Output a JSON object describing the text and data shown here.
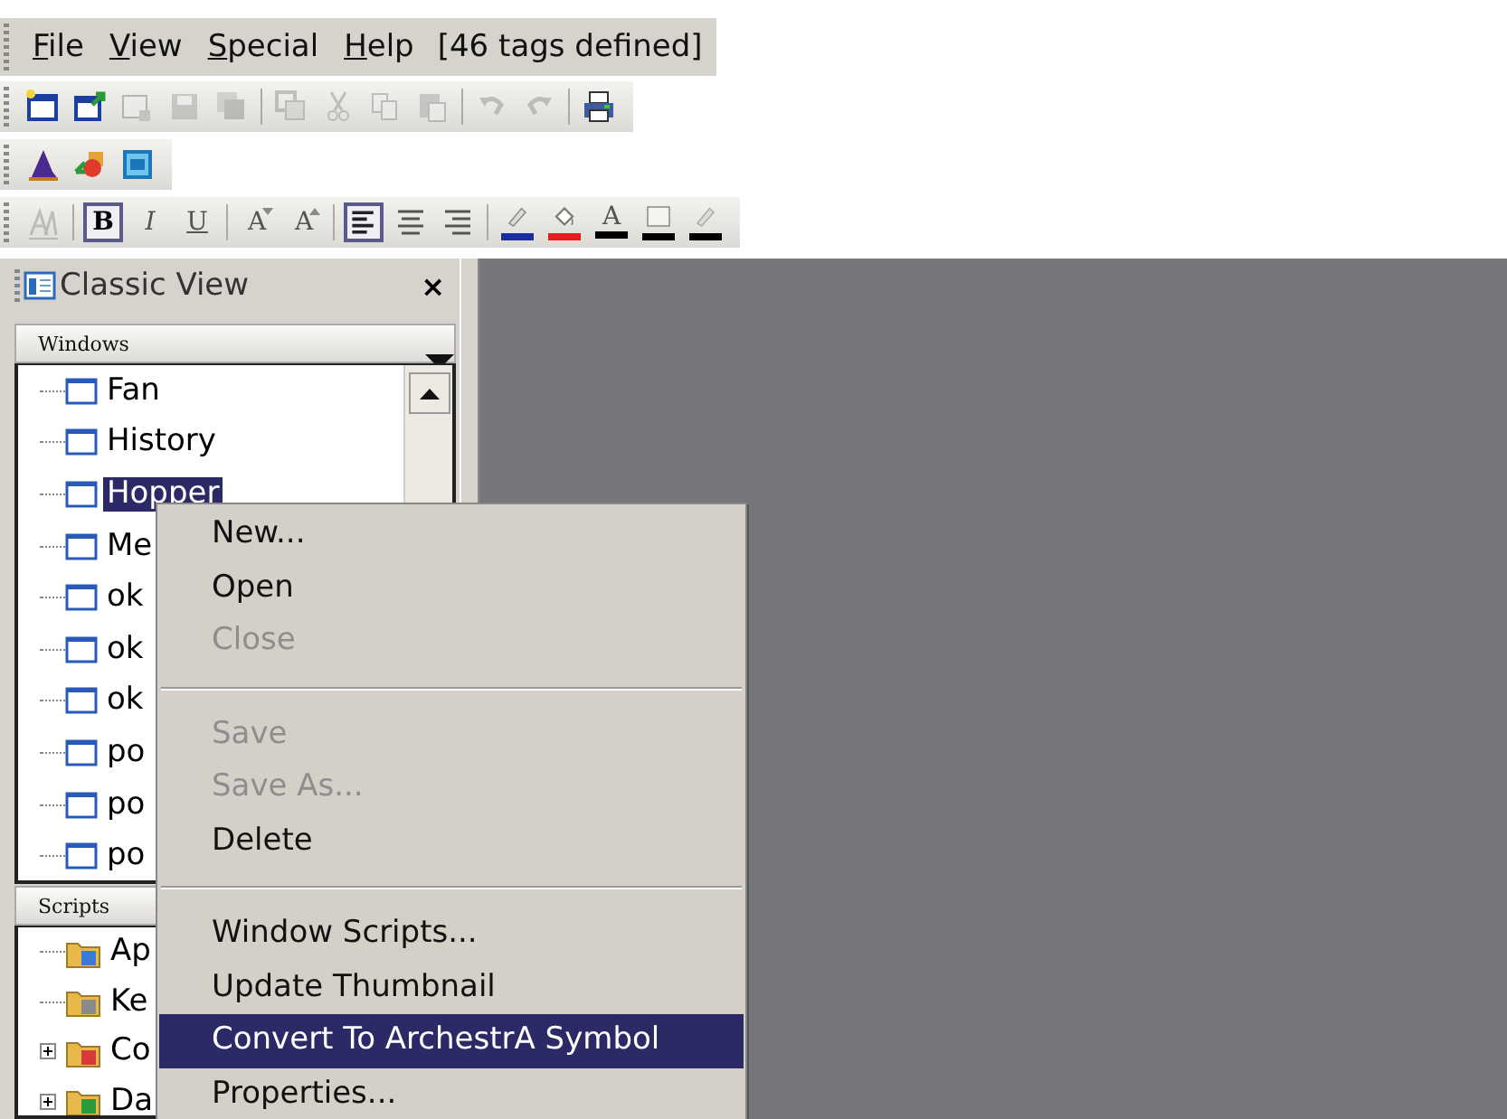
{
  "menu_bar": {
    "items": [
      "File",
      "View",
      "Special",
      "Help"
    ],
    "info": "[46 tags defined]"
  },
  "toolbars": [
    {
      "buttons": [
        {
          "kind": "new",
          "disabled": false
        },
        {
          "kind": "open",
          "disabled": false
        },
        {
          "kind": "close",
          "disabled": true
        },
        {
          "kind": "save",
          "disabled": true
        },
        {
          "kind": "saveall",
          "disabled": true
        },
        {
          "kind": "separator"
        },
        {
          "kind": "duplicate",
          "disabled": true
        },
        {
          "kind": "cut",
          "disabled": true
        },
        {
          "kind": "copy",
          "disabled": true
        },
        {
          "kind": "paste",
          "disabled": true
        },
        {
          "kind": "separator"
        },
        {
          "kind": "undo",
          "disabled": true
        },
        {
          "kind": "redo",
          "disabled": true
        },
        {
          "kind": "separator"
        },
        {
          "kind": "print",
          "disabled": false
        }
      ]
    },
    {
      "buttons": [
        {
          "kind": "wizard",
          "disabled": false
        },
        {
          "kind": "shapes",
          "disabled": false
        },
        {
          "kind": "script",
          "disabled": false
        }
      ]
    },
    {
      "buttons": [
        {
          "kind": "font",
          "disabled": true
        },
        {
          "kind": "separator"
        },
        {
          "kind": "bold",
          "label": "B",
          "pressed": true
        },
        {
          "kind": "italic",
          "label": "I",
          "pressed": false
        },
        {
          "kind": "underline",
          "label": "U",
          "pressed": false
        },
        {
          "kind": "separator"
        },
        {
          "kind": "smaller",
          "label": "A",
          "pressed": false
        },
        {
          "kind": "larger",
          "label": "A",
          "pressed": false
        },
        {
          "kind": "separator"
        },
        {
          "kind": "left",
          "pressed": true
        },
        {
          "kind": "center",
          "pressed": false
        },
        {
          "kind": "right",
          "pressed": false
        },
        {
          "kind": "separator"
        },
        {
          "kind": "linecolor",
          "color": "#1c2fa0"
        },
        {
          "kind": "fillcolor",
          "color": "#e02020"
        },
        {
          "kind": "textcolor",
          "label": "A",
          "color": "#000000"
        },
        {
          "kind": "windowcolor",
          "color": "#000000"
        },
        {
          "kind": "linestyle",
          "color": "#000000"
        }
      ]
    }
  ],
  "panel": {
    "title": "Classic View",
    "close": "×",
    "windows": {
      "title": "Windows",
      "items": [
        {
          "label": "Fan",
          "selected": false
        },
        {
          "label": "History",
          "selected": false
        },
        {
          "label": "Hopper",
          "selected": true
        },
        {
          "label": "Me",
          "selected": false
        },
        {
          "label": "ok",
          "selected": false
        },
        {
          "label": "ok",
          "selected": false
        },
        {
          "label": "ok",
          "selected": false
        },
        {
          "label": "po",
          "selected": false
        },
        {
          "label": "po",
          "selected": false
        },
        {
          "label": "po",
          "selected": false
        }
      ]
    },
    "scripts": {
      "title": "Scripts",
      "items": [
        {
          "label": "Ap",
          "kind": "app"
        },
        {
          "label": "Ke",
          "kind": "key"
        },
        {
          "label": "Co",
          "kind": "condition",
          "expanded": false
        },
        {
          "label": "Da",
          "kind": "data",
          "expanded": false
        }
      ]
    }
  },
  "context_menu": [
    {
      "kind": "item",
      "label": "New...",
      "disabled": false,
      "selected": false
    },
    {
      "kind": "item",
      "label": "Open",
      "disabled": false,
      "selected": false
    },
    {
      "kind": "item",
      "label": "Close",
      "disabled": true,
      "selected": false
    },
    {
      "kind": "separator"
    },
    {
      "kind": "item",
      "label": "Save",
      "disabled": true,
      "selected": false
    },
    {
      "kind": "item",
      "label": "Save As...",
      "disabled": true,
      "selected": false
    },
    {
      "kind": "item",
      "label": "Delete",
      "disabled": false,
      "selected": false
    },
    {
      "kind": "separator"
    },
    {
      "kind": "item",
      "label": "Window Scripts...",
      "disabled": false,
      "selected": false
    },
    {
      "kind": "item",
      "label": "Update Thumbnail",
      "disabled": false,
      "selected": false
    },
    {
      "kind": "item",
      "label": "Convert To ArchestrA Symbol",
      "disabled": false,
      "selected": true
    },
    {
      "kind": "item",
      "label": "Properties...",
      "disabled": false,
      "selected": false
    }
  ]
}
